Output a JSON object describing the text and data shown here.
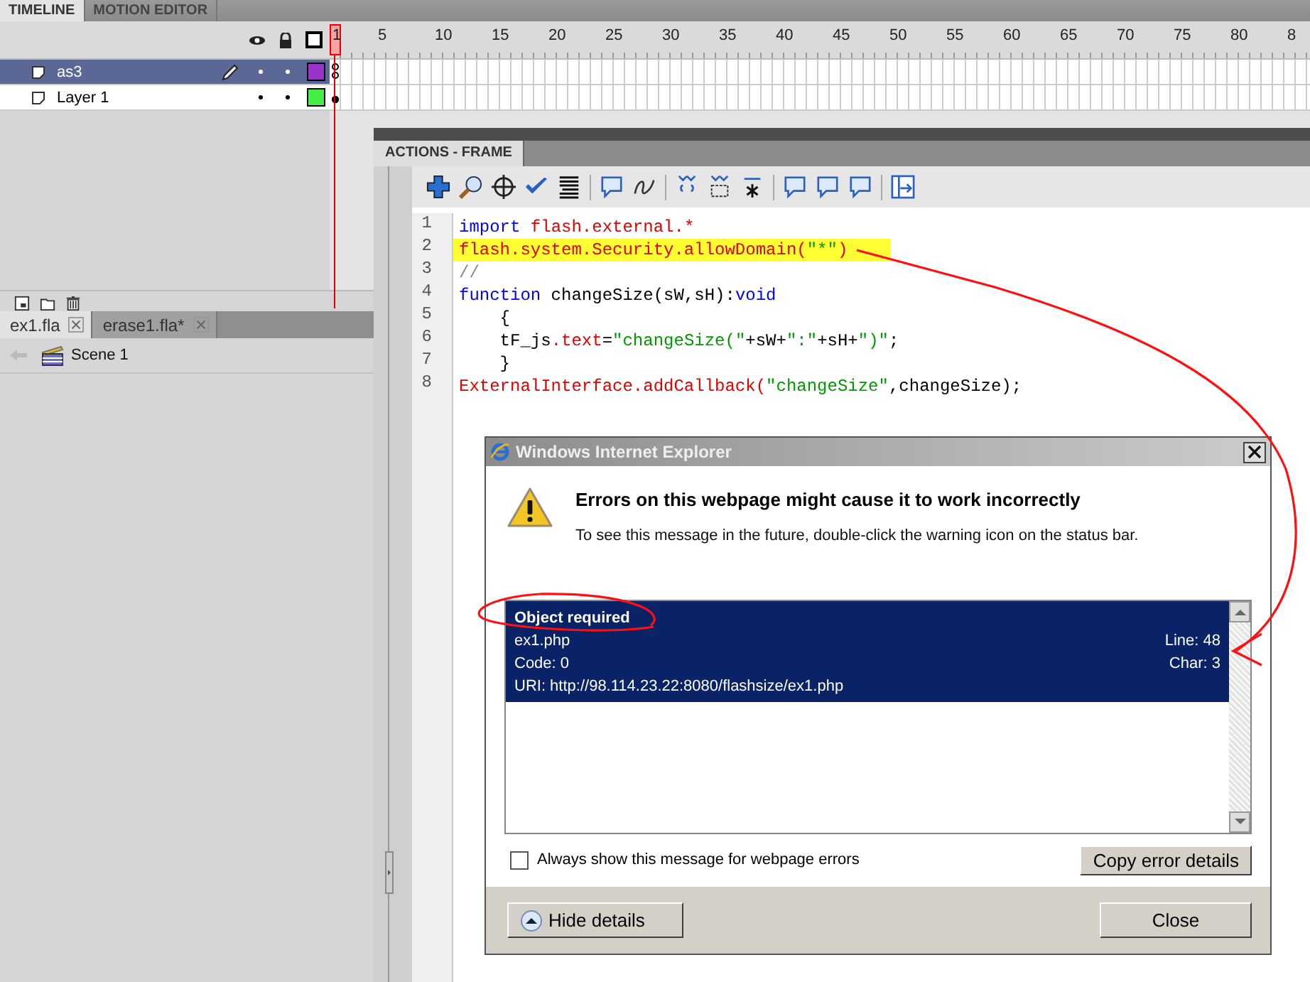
{
  "timeline": {
    "tabs": [
      {
        "label": "TIMELINE",
        "selected": true
      },
      {
        "label": "MOTION EDITOR",
        "selected": false
      }
    ],
    "frame_ruler": [
      "1",
      "5",
      "10",
      "15",
      "20",
      "25",
      "30",
      "35",
      "40",
      "45",
      "50",
      "55",
      "60",
      "65",
      "70",
      "75",
      "80",
      "8"
    ],
    "layers": [
      {
        "name": "as3",
        "selected": true,
        "color": "#9933cc",
        "keyframe": {
          "kind": "action"
        }
      },
      {
        "name": "Layer 1",
        "selected": false,
        "color": "#44ee44",
        "keyframe": {
          "kind": "filled"
        }
      }
    ]
  },
  "documents": {
    "tabs": [
      {
        "label": "ex1.fla",
        "selected": true
      },
      {
        "label": "erase1.fla*",
        "selected": false
      }
    ],
    "scene": "Scene 1"
  },
  "actions_panel": {
    "title": "ACTIONS - FRAME",
    "lines": [
      {
        "number": "1",
        "highlighted": false,
        "segments": [
          {
            "text": "import",
            "kind": "keyword"
          },
          {
            "text": " flash.external.*",
            "kind": "builtin"
          }
        ]
      },
      {
        "number": "2",
        "highlighted": true,
        "segments": [
          {
            "text": "flash.system.Security.allowDomain(",
            "kind": "builtin"
          },
          {
            "text": "\"*\"",
            "kind": "string"
          },
          {
            "text": ")",
            "kind": "builtin"
          }
        ]
      },
      {
        "number": "3",
        "highlighted": false,
        "segments": [
          {
            "text": "//",
            "kind": "comment"
          }
        ]
      },
      {
        "number": "4",
        "highlighted": false,
        "segments": [
          {
            "text": "function",
            "kind": "keyword"
          },
          {
            "text": " changeSize(sW,sH):",
            "kind": "plain"
          },
          {
            "text": "void",
            "kind": "keyword"
          }
        ]
      },
      {
        "number": "5",
        "highlighted": false,
        "segments": [
          {
            "text": "    {",
            "kind": "plain"
          }
        ]
      },
      {
        "number": "6",
        "highlighted": false,
        "segments": [
          {
            "text": "    tF_js",
            "kind": "plain"
          },
          {
            "text": ".text",
            "kind": "builtin"
          },
          {
            "text": "=",
            "kind": "plain"
          },
          {
            "text": "\"changeSize(\"",
            "kind": "string"
          },
          {
            "text": "+sW+",
            "kind": "plain"
          },
          {
            "text": "\":\"",
            "kind": "string"
          },
          {
            "text": "+sH+",
            "kind": "plain"
          },
          {
            "text": "\")\"",
            "kind": "string"
          },
          {
            "text": ";",
            "kind": "plain"
          }
        ]
      },
      {
        "number": "7",
        "highlighted": false,
        "segments": [
          {
            "text": "    }",
            "kind": "plain"
          }
        ]
      },
      {
        "number": "8",
        "highlighted": false,
        "segments": [
          {
            "text": "ExternalInterface.addCallback(",
            "kind": "builtin"
          },
          {
            "text": "\"changeSize\"",
            "kind": "string"
          },
          {
            "text": ",changeSize);",
            "kind": "plain"
          }
        ]
      }
    ]
  },
  "error_dialog": {
    "title": "Windows Internet Explorer",
    "heading": "Errors on this webpage might cause it to work incorrectly",
    "message": "To see this message in the future, double-click the warning icon on the status bar.",
    "errors": [
      {
        "selected": true,
        "title": "Object required",
        "file": "ex1.php",
        "line": "Line: 48",
        "code": "Code: 0",
        "char": "Char: 3",
        "uri": "URI: http://98.114.23.22:8080/flashsize/ex1.php"
      }
    ],
    "always_show": {
      "label": "Always show this message for webpage errors",
      "checked": false
    },
    "copy_button": "Copy error details",
    "details_button": "Hide details",
    "close_button": "Close"
  }
}
